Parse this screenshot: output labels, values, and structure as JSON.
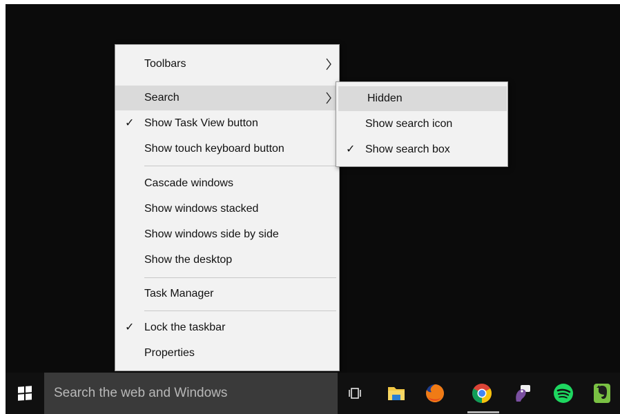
{
  "context_menu": {
    "items": [
      {
        "label": "Toolbars",
        "checked": false,
        "has_submenu": true
      },
      {
        "label": "Search",
        "checked": false,
        "has_submenu": true,
        "highlighted": true
      },
      {
        "label": "Show Task View button",
        "checked": true
      },
      {
        "label": "Show touch keyboard button",
        "checked": false
      },
      {
        "label": "Cascade windows"
      },
      {
        "label": "Show windows stacked"
      },
      {
        "label": "Show windows side by side"
      },
      {
        "label": "Show the desktop"
      },
      {
        "label": "Task Manager"
      },
      {
        "label": "Lock the taskbar",
        "checked": true
      },
      {
        "label": "Properties"
      }
    ],
    "check_glyph": "✓",
    "arrow_glyph": "›"
  },
  "search_submenu": {
    "items": [
      {
        "label": "Hidden",
        "highlighted": true,
        "checked": false
      },
      {
        "label": "Show search icon",
        "checked": false
      },
      {
        "label": "Show search box",
        "checked": true
      }
    ]
  },
  "taskbar": {
    "search_placeholder": "Search the web and Windows",
    "icons": [
      "windows-start-icon",
      "task-view-icon",
      "file-explorer-icon",
      "firefox-icon",
      "chrome-icon",
      "pidgin-icon",
      "spotify-icon",
      "evernote-icon"
    ]
  },
  "colors": {
    "desktop": "#0b0b0b",
    "menu_bg": "#f2f2f2",
    "highlight": "#dadada",
    "taskbar": "#101010",
    "search_box": "#3a3a3a"
  }
}
